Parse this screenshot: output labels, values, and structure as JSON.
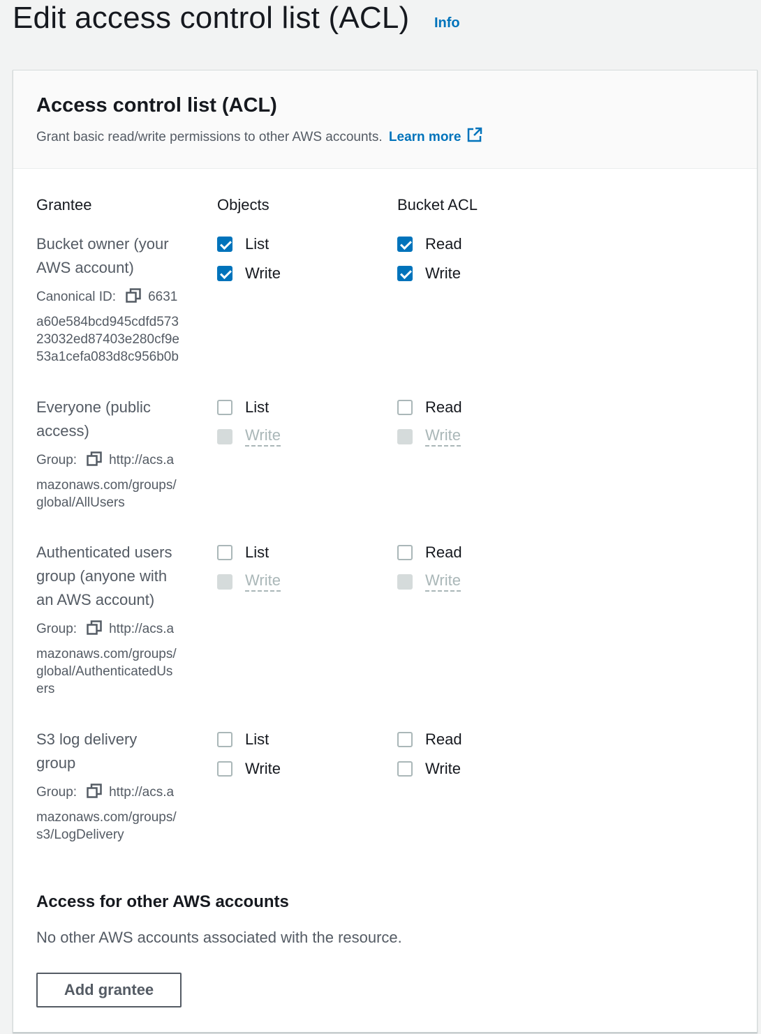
{
  "page": {
    "title": "Edit access control list (ACL)",
    "info_link": "Info"
  },
  "panel": {
    "title": "Access control list (ACL)",
    "description": "Grant basic read/write permissions to other AWS accounts.",
    "learn_more": "Learn more"
  },
  "columns": {
    "grantee": "Grantee",
    "objects": "Objects",
    "bucket_acl": "Bucket ACL"
  },
  "grantees": [
    {
      "name_line1": "Bucket owner (your",
      "name_line2": "AWS account)",
      "id_label": "Canonical ID:",
      "id_first": "6631",
      "id_rest": [
        "a60e584bcd945cdfd573",
        "23032ed87403e280cf9e",
        "53a1cefa083d8c956b0b"
      ],
      "objects_list": {
        "label": "List",
        "checked": true,
        "disabled": false
      },
      "objects_write": {
        "label": "Write",
        "checked": true,
        "disabled": false
      },
      "bucket_read": {
        "label": "Read",
        "checked": true,
        "disabled": false
      },
      "bucket_write": {
        "label": "Write",
        "checked": true,
        "disabled": false
      }
    },
    {
      "name_line1": "Everyone (public",
      "name_line2": "access)",
      "id_label": "Group:",
      "id_first": "http://acs.a",
      "id_rest": [
        "mazonaws.com/groups/",
        "global/AllUsers"
      ],
      "objects_list": {
        "label": "List",
        "checked": false,
        "disabled": false
      },
      "objects_write": {
        "label": "Write",
        "checked": false,
        "disabled": true
      },
      "bucket_read": {
        "label": "Read",
        "checked": false,
        "disabled": false
      },
      "bucket_write": {
        "label": "Write",
        "checked": false,
        "disabled": true
      }
    },
    {
      "name_line1": "Authenticated users",
      "name_line2": "group (anyone with",
      "name_line3": "an AWS account)",
      "id_label": "Group:",
      "id_first": "http://acs.a",
      "id_rest": [
        "mazonaws.com/groups/",
        "global/AuthenticatedUs",
        "ers"
      ],
      "objects_list": {
        "label": "List",
        "checked": false,
        "disabled": false
      },
      "objects_write": {
        "label": "Write",
        "checked": false,
        "disabled": true
      },
      "bucket_read": {
        "label": "Read",
        "checked": false,
        "disabled": false
      },
      "bucket_write": {
        "label": "Write",
        "checked": false,
        "disabled": true
      }
    },
    {
      "name_line1": "S3 log delivery",
      "name_line2": "group",
      "id_label": "Group:",
      "id_first": "http://acs.a",
      "id_rest": [
        "mazonaws.com/groups/",
        "s3/LogDelivery"
      ],
      "objects_list": {
        "label": "List",
        "checked": false,
        "disabled": false
      },
      "objects_write": {
        "label": "Write",
        "checked": false,
        "disabled": false
      },
      "bucket_read": {
        "label": "Read",
        "checked": false,
        "disabled": false
      },
      "bucket_write": {
        "label": "Write",
        "checked": false,
        "disabled": false
      }
    }
  ],
  "other_accounts": {
    "title": "Access for other AWS accounts",
    "text": "No other AWS accounts associated with the resource.",
    "add_button": "Add grantee"
  },
  "colors": {
    "link": "#0073bb",
    "checked": "#0073bb",
    "disabled": "#d5dbdb"
  }
}
